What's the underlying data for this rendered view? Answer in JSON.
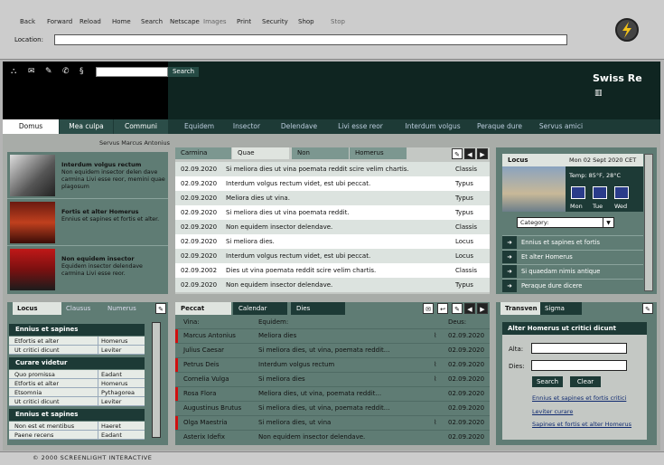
{
  "browser": {
    "toolbar": [
      "Back",
      "Forward",
      "Reload",
      "Home",
      "Search",
      "Netscape",
      "Images",
      "Print",
      "Security",
      "Shop",
      "Stop"
    ],
    "location_label": "Location:",
    "location_value": ""
  },
  "header": {
    "search_button": "Search",
    "brand": "Swiss Re"
  },
  "nav": {
    "tabs": [
      "Domus",
      "Mea culpa",
      "Communi",
      "Equidem",
      "Insector",
      "Delendave",
      "Livi esse reor",
      "Interdum volgus",
      "Peraque dure",
      "Servus amici"
    ]
  },
  "servus": "Servus Marcus Antonius",
  "left_news": [
    {
      "title": "Interdum volgus rectum",
      "text": "Non equidem insector delen dave carmina Livi esse reor, memini quae plagosum"
    },
    {
      "title": "Fortis et alter Homerus",
      "text": "Ennius et sapines et fortis et alter."
    },
    {
      "title": "Non equidem insector",
      "text": "Equidem insector delendave carmina Livi esse reor."
    }
  ],
  "center": {
    "tabs": [
      "Carmina",
      "Quae",
      "Non",
      "Homerus"
    ],
    "rows": [
      {
        "date": "02.09.2020",
        "text": "Si meliora dies ut vina poemata reddit scire velim chartis.",
        "type": "Classis"
      },
      {
        "date": "02.09.2020",
        "text": "Interdum volgus rectum videt, est ubi peccat.",
        "type": "Typus"
      },
      {
        "date": "02.09.2020",
        "text": "Meliora dies ut vina.",
        "type": "Typus"
      },
      {
        "date": "02.09.2020",
        "text": "Si meliora dies ut vina poemata reddit.",
        "type": "Typus"
      },
      {
        "date": "02.09.2020",
        "text": "Non equidem insector delendave.",
        "type": "Classis"
      },
      {
        "date": "02.09.2020",
        "text": "Si meliora dies.",
        "type": "Locus"
      },
      {
        "date": "02.09.2020",
        "text": "Interdum volgus rectum videt, est ubi peccat.",
        "type": "Locus"
      },
      {
        "date": "02.09.2002",
        "text": "Dies ut vina poemata reddit scire velim chartis.",
        "type": "Classis"
      },
      {
        "date": "02.09.2020",
        "text": "Non equidem insector delendave.",
        "type": "Typus"
      }
    ]
  },
  "locus": {
    "title": "Locus",
    "date": "Mon 02 Sept 2020 CET",
    "temp": "Temp: 85°F, 28°C",
    "days": [
      "Mon",
      "Tue",
      "Wed"
    ],
    "category_label": "Category:",
    "links": [
      "Ennius et sapines et fortis",
      "Et alter Homerus",
      "Si quaedam nimis antique",
      "Peraque dure dicere"
    ]
  },
  "bleft": {
    "tabs": [
      "Locus",
      "Clausus",
      "Numerus"
    ],
    "sections": [
      {
        "title": "Ennius et sapines",
        "rows": [
          [
            "Etfortis et alter",
            "Homerus"
          ],
          [
            "Ut critici dicunt",
            "Leviter"
          ]
        ]
      },
      {
        "title": "Curare videtur",
        "rows": [
          [
            "Quo promissa",
            "Eadant"
          ],
          [
            "Etfortis et alter",
            "Homerus"
          ],
          [
            "Etsomnia",
            "Pythagorea"
          ],
          [
            "Ut critici dicunt",
            "Leviter"
          ]
        ]
      },
      {
        "title": "Ennius et sapines",
        "rows": [
          [
            "Non est et mentibus",
            "Haeret"
          ],
          [
            "Paene recens",
            "Eadant"
          ]
        ]
      }
    ]
  },
  "peccat": {
    "tabs": [
      "Peccat",
      "Calendar",
      "Dies"
    ],
    "headers": [
      "Vina:",
      "Equidem:",
      "Deus:"
    ],
    "rows": [
      {
        "name": "Marcus Antonius",
        "text": "Meliora dies",
        "date": "02.09.2020",
        "clip": true,
        "mark": true
      },
      {
        "name": "Julius Caesar",
        "text": "Si meliora dies, ut vina, poemata reddit...",
        "date": "02.09.2020",
        "clip": false,
        "mark": false
      },
      {
        "name": "Petrus Deis",
        "text": "Interdum volgus rectum",
        "date": "02.09.2020",
        "clip": true,
        "mark": true
      },
      {
        "name": "Cornelia Vulga",
        "text": "Si meliora dies",
        "date": "02.09.2020",
        "clip": true,
        "mark": false
      },
      {
        "name": "Rosa Flora",
        "text": "Meliora dies, ut vina, poemata reddit...",
        "date": "02.09.2020",
        "clip": false,
        "mark": true
      },
      {
        "name": "Augustinus Brutus",
        "text": "Si meliora dies, ut vina, poemata reddit...",
        "date": "02.09.2020",
        "clip": false,
        "mark": false
      },
      {
        "name": "Olga Maestria",
        "text": "Si meliora dies, ut vina",
        "date": "02.09.2020",
        "clip": true,
        "mark": true
      },
      {
        "name": "Asterix Idefix",
        "text": "Non equidem insector delendave.",
        "date": "02.09.2020",
        "clip": false,
        "mark": false
      }
    ]
  },
  "trans": {
    "tabs": [
      "Transven",
      "Sigma"
    ],
    "title": "Alter Homerus ut critici dicunt",
    "alta_label": "Alta:",
    "dies_label": "Dies:",
    "search": "Search",
    "clear": "Clear",
    "links": [
      "Ennius et sapines et fortis critici",
      "Leviter curare",
      "Sapines et fortis et alter Homerus"
    ]
  },
  "status": {
    "copyright": "© 2000 SCREENLIGHT INTERACTIVE"
  },
  "colors": {
    "dark": "#1d3a36",
    "mid": "#5f7c74",
    "accent": "#d01010"
  }
}
